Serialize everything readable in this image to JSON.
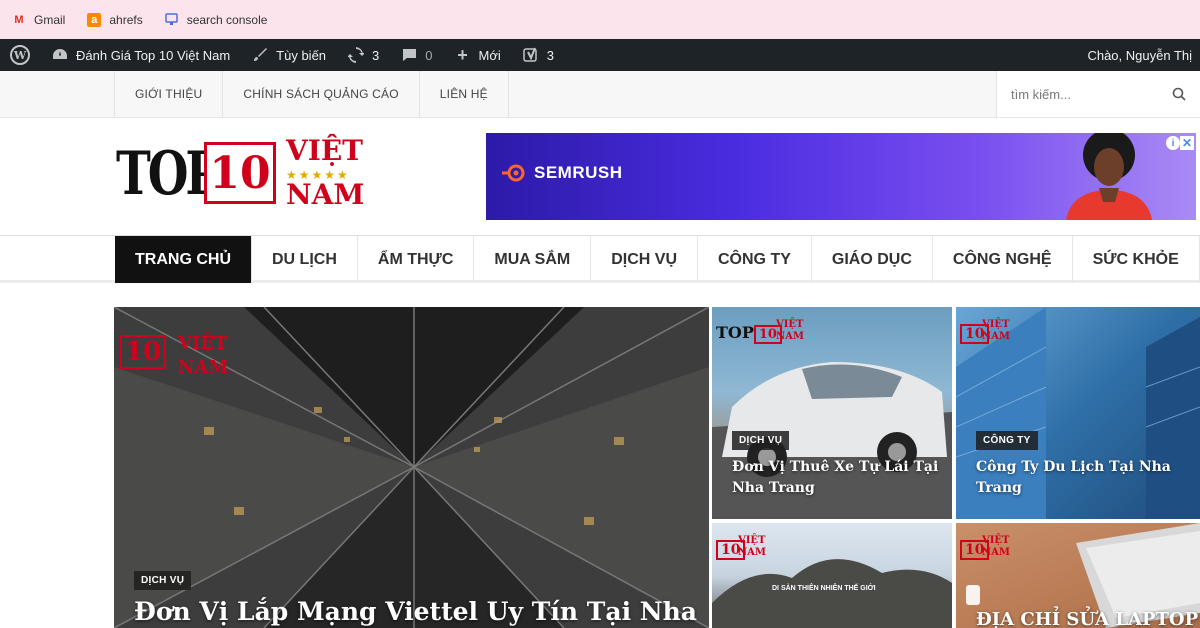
{
  "bookmarks": [
    {
      "label": "Gmail",
      "icon": "gmail-icon"
    },
    {
      "label": "ahrefs",
      "icon": "ahrefs-icon"
    },
    {
      "label": "search console",
      "icon": "search-console-icon"
    }
  ],
  "adminbar": {
    "site_name": "Đánh Giá Top 10 Việt Nam",
    "customize": "Tùy biến",
    "updates_count": "3",
    "comments_count": "0",
    "new_label": "Mới",
    "yoast_count": "3",
    "greeting": "Chào, Nguyễn Thị"
  },
  "topnav": {
    "links": [
      "GIỚI THIỆU",
      "CHÍNH SÁCH QUẢNG CÁO",
      "LIÊN HỆ"
    ],
    "search_placeholder": "tìm kiếm..."
  },
  "logo": {
    "top": "TOP",
    "ten": "10",
    "viet": "VIỆT",
    "stars": "★★★★★",
    "nam": "NAM"
  },
  "ad": {
    "brand": "SEMRUSH",
    "info": "i",
    "close": "✕"
  },
  "mainnav": {
    "items": [
      "TRANG CHỦ",
      "DU LỊCH",
      "ẨM THỰC",
      "MUA SẮM",
      "DỊCH VỤ",
      "CÔNG TY",
      "GIÁO DỤC",
      "CÔNG NGHỆ",
      "SỨC KHỎE"
    ],
    "active_index": 0
  },
  "featured": [
    {
      "category": "DỊCH VỤ",
      "title": "Đơn Vị Lắp Mạng Viettel Uy Tín Tại Nha"
    },
    {
      "category": "DỊCH VỤ",
      "title": "Đơn Vị Thuê Xe Tự Lái Tại Nha Trang"
    },
    {
      "category": "CÔNG TY",
      "title": "Công Ty Du Lịch Tại Nha Trang"
    },
    {
      "category": "",
      "title": ""
    },
    {
      "category": "",
      "title": "ĐỊA CHỈ SỬA LAPTOP"
    }
  ],
  "image_text": {
    "f4_sign": "DI SẢN THIÊN NHIÊN THẾ GIỚI"
  },
  "colors": {
    "bookmarks_bg": "#fce4ec",
    "adminbar_bg": "#1d2327",
    "active_nav_bg": "#111111",
    "logo_red": "#d0021b",
    "ad_purple": "#4a2ce0"
  }
}
